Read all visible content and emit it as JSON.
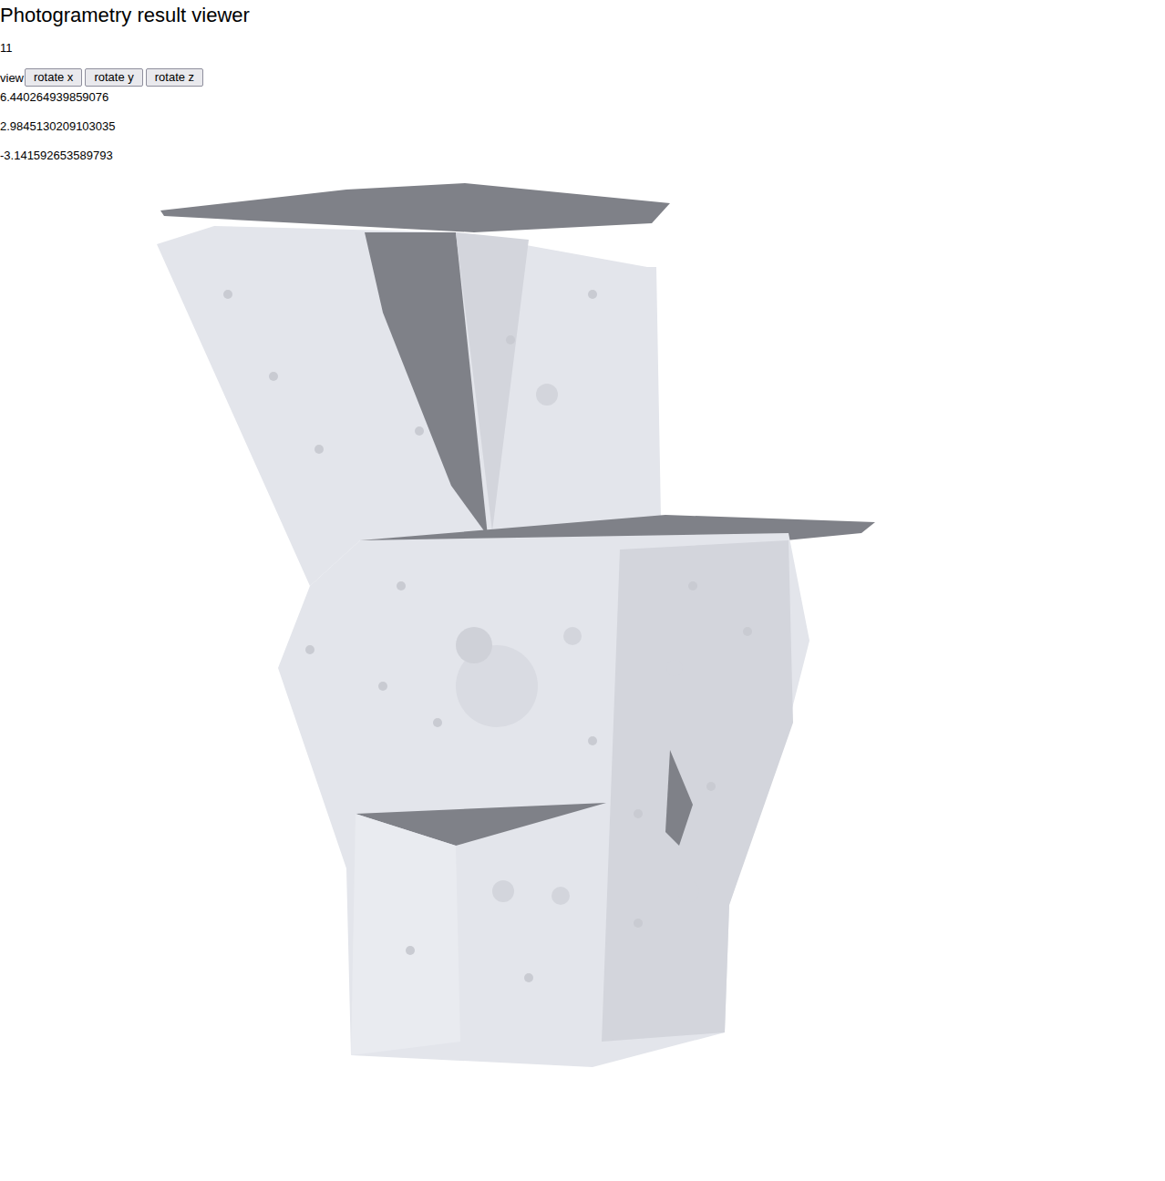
{
  "title": "Photogrametry result viewer",
  "count": "11",
  "view_label": "view",
  "buttons": [
    "rotate x",
    "rotate y",
    "rotate z"
  ],
  "values": [
    "6.440264939859076",
    "2.9845130209103035",
    "-3.141592653589793"
  ]
}
